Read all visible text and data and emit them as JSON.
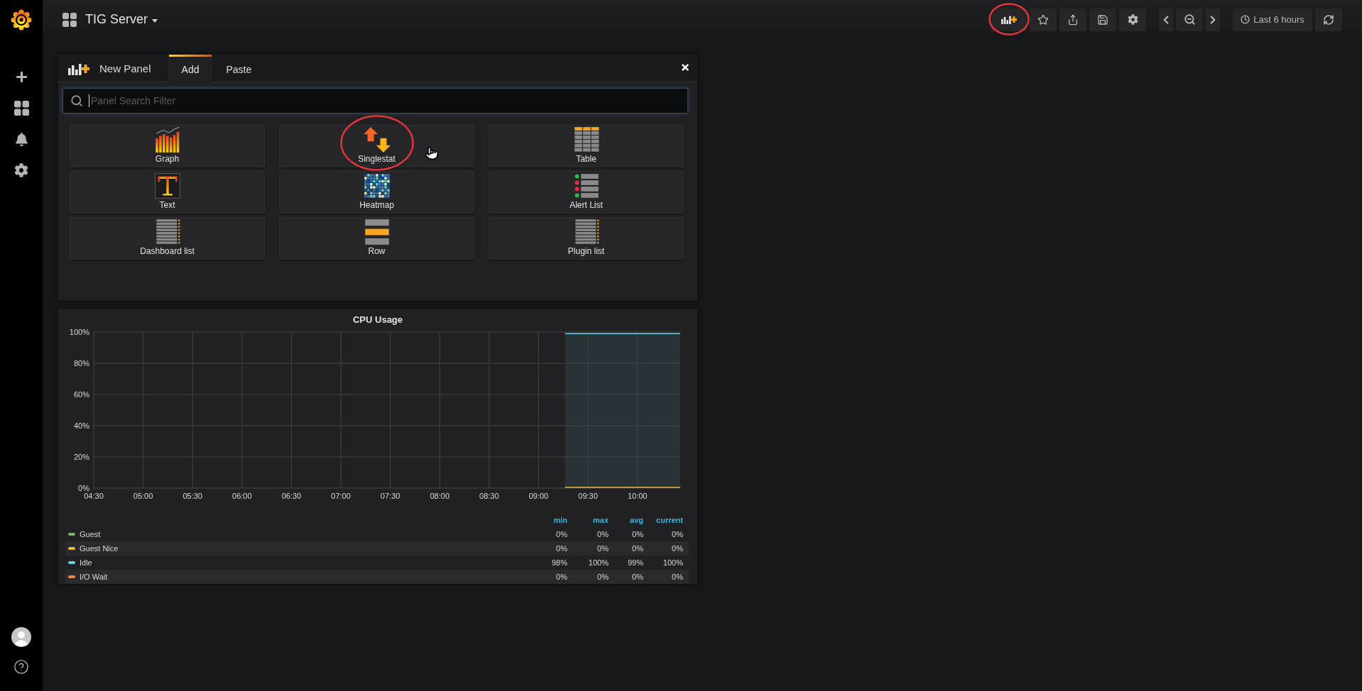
{
  "dashboard": {
    "title": "TIG Server"
  },
  "toolbar": [
    {
      "kind": "add_panel",
      "circled": true
    },
    {
      "kind": "star",
      "circled": false
    },
    {
      "kind": "share",
      "circled": false
    },
    {
      "kind": "save",
      "circled": false
    },
    {
      "kind": "settings",
      "circled": false
    },
    {
      "kind": "back",
      "circled": false
    },
    {
      "kind": "zoom_out",
      "circled": false
    },
    {
      "kind": "forward",
      "circled": false
    },
    {
      "kind": "time_range",
      "label": "Last 6 hours",
      "circled": false
    },
    {
      "kind": "refresh",
      "circled": false
    }
  ],
  "panel_picker": {
    "title": "New Panel",
    "tabs": [
      {
        "label": "Add",
        "selected": true
      },
      {
        "label": "Paste",
        "selected": false
      }
    ],
    "search": {
      "placeholder": "Panel Search Filter"
    },
    "panel_types": [
      {
        "kind": "graph",
        "label": "Graph",
        "circled": false,
        "pointer": false
      },
      {
        "kind": "singlestat",
        "label": "Singlestat",
        "circled": true,
        "pointer": true
      },
      {
        "kind": "table",
        "label": "Table",
        "circled": false,
        "pointer": false
      },
      {
        "kind": "text",
        "label": "Text",
        "circled": false,
        "pointer": false
      },
      {
        "kind": "heatmap",
        "label": "Heatmap",
        "circled": false,
        "pointer": false
      },
      {
        "kind": "alertlist",
        "label": "Alert List",
        "circled": false,
        "pointer": false
      },
      {
        "kind": "dashlist",
        "label": "Dashboard list",
        "circled": false,
        "pointer": false
      },
      {
        "kind": "row",
        "label": "Row",
        "circled": false,
        "pointer": false
      },
      {
        "kind": "pluginlist",
        "label": "Plugin list",
        "circled": false,
        "pointer": false
      }
    ]
  },
  "cpu_panel": {
    "title": "CPU Usage",
    "chart_data": {
      "type": "area",
      "grid": true,
      "x": [
        556,
        626
      ],
      "xlim": [
        270,
        626
      ],
      "ylim": [
        0,
        100
      ],
      "xticks": [
        {
          "value": 270,
          "label": "04:30"
        },
        {
          "value": 300,
          "label": "05:00"
        },
        {
          "value": 330,
          "label": "05:30"
        },
        {
          "value": 360,
          "label": "06:00"
        },
        {
          "value": 390,
          "label": "06:30"
        },
        {
          "value": 420,
          "label": "07:00"
        },
        {
          "value": 450,
          "label": "07:30"
        },
        {
          "value": 480,
          "label": "08:00"
        },
        {
          "value": 510,
          "label": "08:30"
        },
        {
          "value": 540,
          "label": "09:00"
        },
        {
          "value": 570,
          "label": "09:30"
        },
        {
          "value": 600,
          "label": "10:00"
        }
      ],
      "yticks": [
        {
          "value": 0,
          "label": "0%"
        },
        {
          "value": 20,
          "label": "20%"
        },
        {
          "value": 40,
          "label": "40%"
        },
        {
          "value": 60,
          "label": "60%"
        },
        {
          "value": 80,
          "label": "80%"
        },
        {
          "value": 100,
          "label": "100%"
        }
      ],
      "series": [
        {
          "name": "Guest",
          "type": "line",
          "color": "#7eb26d",
          "values": [
            null,
            null
          ]
        },
        {
          "name": "Guest Nice",
          "type": "line",
          "color": "#eab839",
          "values": [
            0.5,
            0.5
          ]
        },
        {
          "name": "Idle",
          "type": "area",
          "color": "#6ed0e0",
          "values": [
            99,
            99
          ]
        },
        {
          "name": "I/O Wait",
          "type": "line",
          "color": "#ef843c",
          "values": [
            null,
            null
          ]
        }
      ]
    },
    "legend": {
      "columns": [
        "min",
        "max",
        "avg",
        "current"
      ],
      "rows": [
        {
          "values": [
            "0%",
            "0%",
            "0%",
            "0%"
          ]
        },
        {
          "values": [
            "0%",
            "0%",
            "0%",
            "0%"
          ]
        },
        {
          "values": [
            "98%",
            "100%",
            "99%",
            "100%"
          ]
        },
        {
          "values": [
            "0%",
            "0%",
            "0%",
            "0%"
          ]
        }
      ]
    }
  }
}
